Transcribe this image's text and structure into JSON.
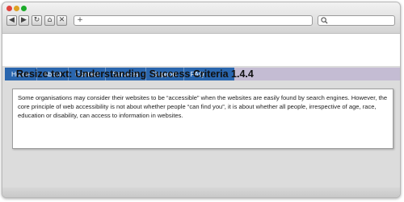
{
  "browser": {
    "buttons": {
      "back": "◀",
      "forward": "▶",
      "reload": "↻",
      "home": "⌂",
      "stop": "✕",
      "new_tab": "+"
    },
    "url": "",
    "search_value": ""
  },
  "nav": {
    "items": [
      "Home",
      "About",
      "Contact",
      "Services",
      "Support",
      "FAQ"
    ]
  },
  "page": {
    "title": "Resize text: Understanding Success Criteria 1.4.4",
    "body": "Some organisations may consider their websites to be “accessible” when the websites are easily found by search engines. However, the core principle of web accessibility is not about whether people “can find you”, it is about whether all people, irrespective of age, race, education or disability, can access to information in websites."
  },
  "colors": {
    "menu_bg": "#2a66ae",
    "menu_strip": "#c4bcd3",
    "page_bg": "#dcdcdc"
  }
}
